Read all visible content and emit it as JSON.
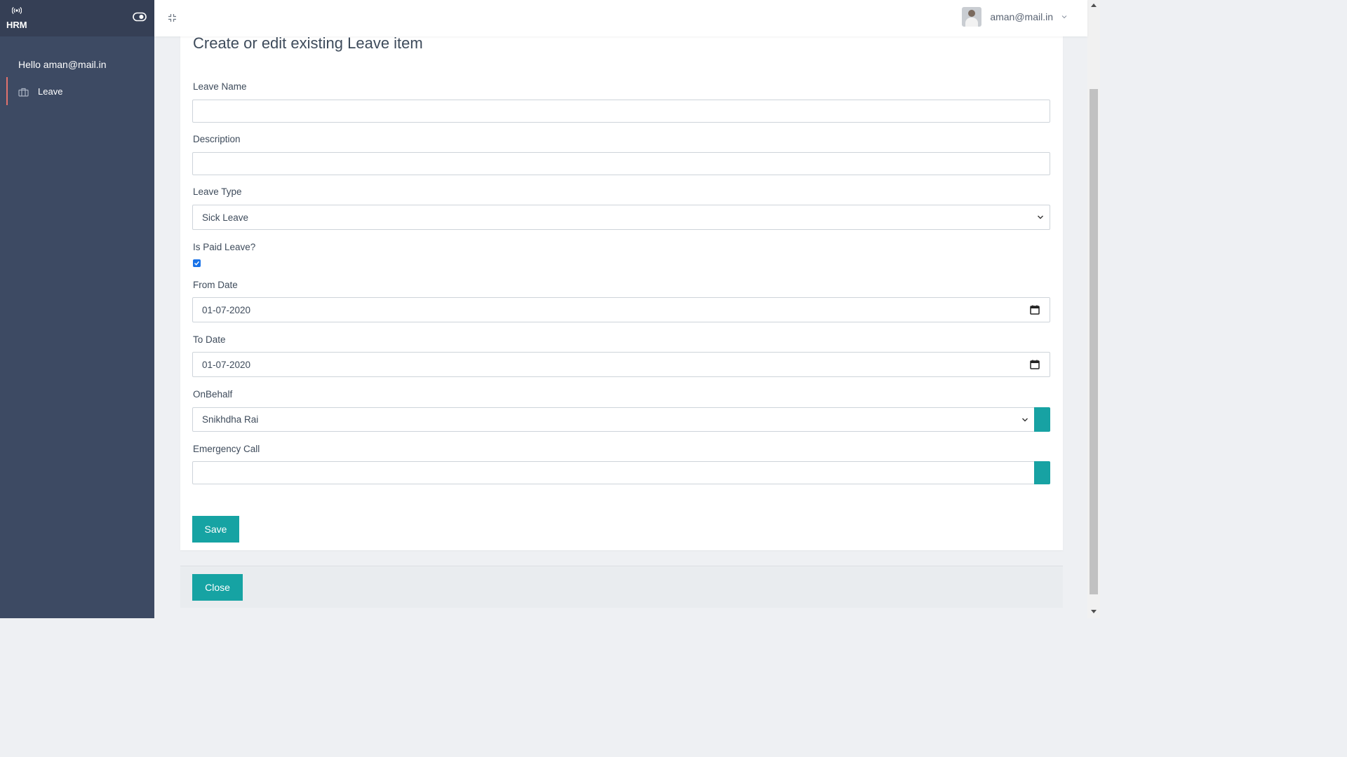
{
  "app": {
    "name": "HRM"
  },
  "sidebar": {
    "greeting": "Hello aman@mail.in",
    "items": [
      {
        "label": "Leave",
        "icon": "briefcase-icon",
        "active": true
      }
    ],
    "active_indicator_color": "#e2726d"
  },
  "header": {
    "user_email": "aman@mail.in"
  },
  "form": {
    "title": "Create or edit existing Leave item",
    "leave_name": {
      "label": "Leave Name",
      "value": ""
    },
    "description": {
      "label": "Description",
      "value": ""
    },
    "leave_type": {
      "label": "Leave Type",
      "selected": "Sick Leave"
    },
    "is_paid": {
      "label": "Is Paid Leave?",
      "checked": true
    },
    "from_date": {
      "label": "From Date",
      "value": "01-07-2020"
    },
    "to_date": {
      "label": "To Date",
      "value": "01-07-2020"
    },
    "on_behalf": {
      "label": "OnBehalf",
      "selected": "Snikhdha Rai"
    },
    "emergency_call": {
      "label": "Emergency Call",
      "value": ""
    },
    "save_label": "Save"
  },
  "footer": {
    "close_label": "Close"
  },
  "colors": {
    "accent": "#16a3a3",
    "sidebar_bg": "#3d4a63",
    "checkbox": "#1a73e8"
  }
}
